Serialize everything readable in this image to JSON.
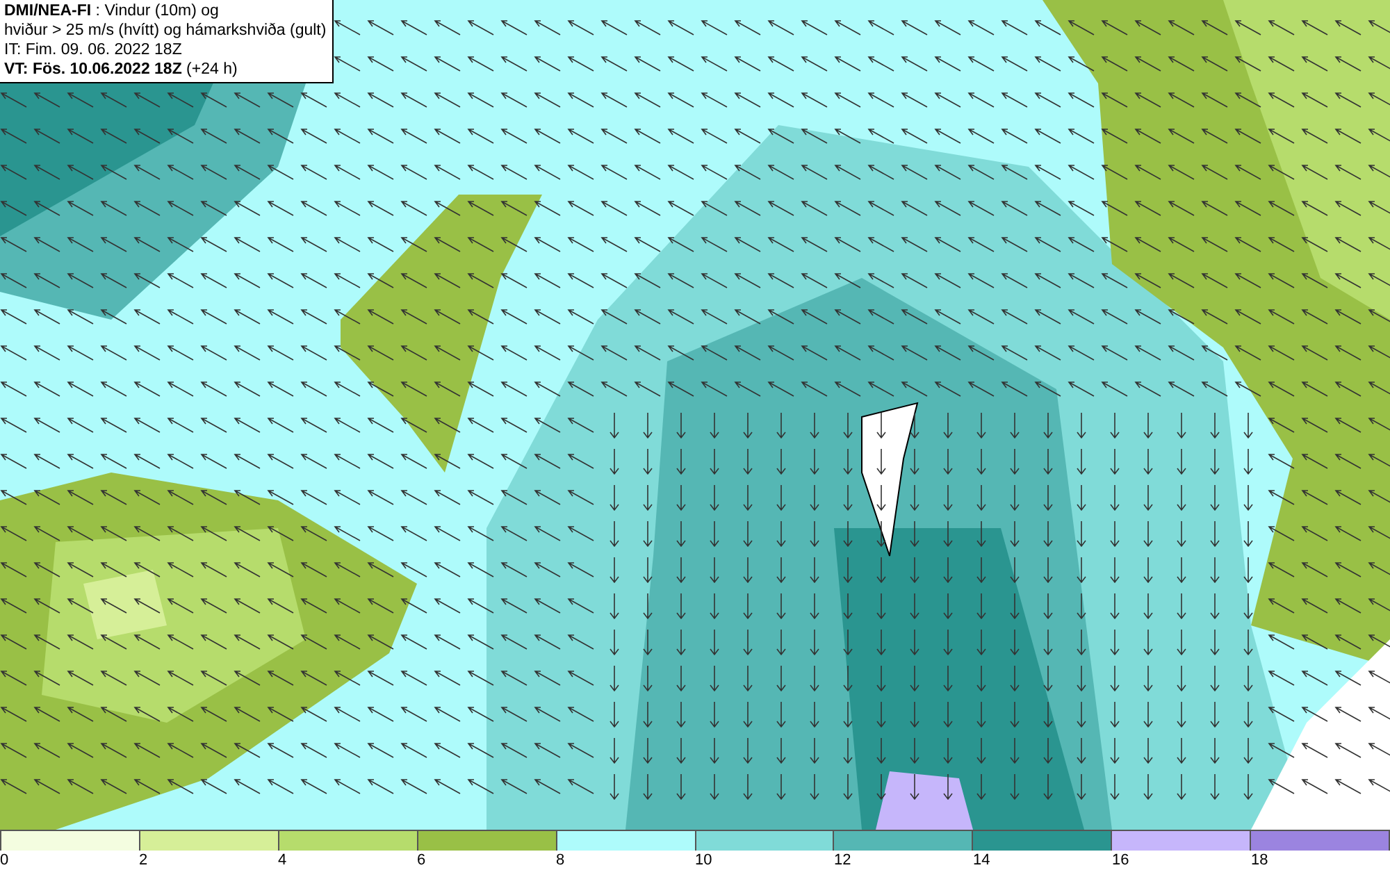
{
  "legend": {
    "lines": [
      "**DMI/NEA-FI** : Vindur (10m) og",
      "hviður > 25 m/s (hvítt) og hámarkshviða (gult)",
      "IT: Fim. 09. 06. 2022 18Z",
      "**VT: Fös. 10.06.2022 18Z** (+24 h)"
    ]
  },
  "colorbar": {
    "segments": [
      {
        "color": "#f4fde0"
      },
      {
        "color": "#d6ef98"
      },
      {
        "color": "#b6dc6c"
      },
      {
        "color": "#99c046"
      },
      {
        "color": "#aefbfb"
      },
      {
        "color": "#80dbd8"
      },
      {
        "color": "#55b7b4"
      },
      {
        "color": "#2a9590"
      },
      {
        "color": "#c6b6fb"
      },
      {
        "color": "#9b84e0"
      }
    ],
    "ticks": [
      "0",
      "2",
      "4",
      "6",
      "8",
      "10",
      "12",
      "14",
      "16",
      "18"
    ]
  }
}
